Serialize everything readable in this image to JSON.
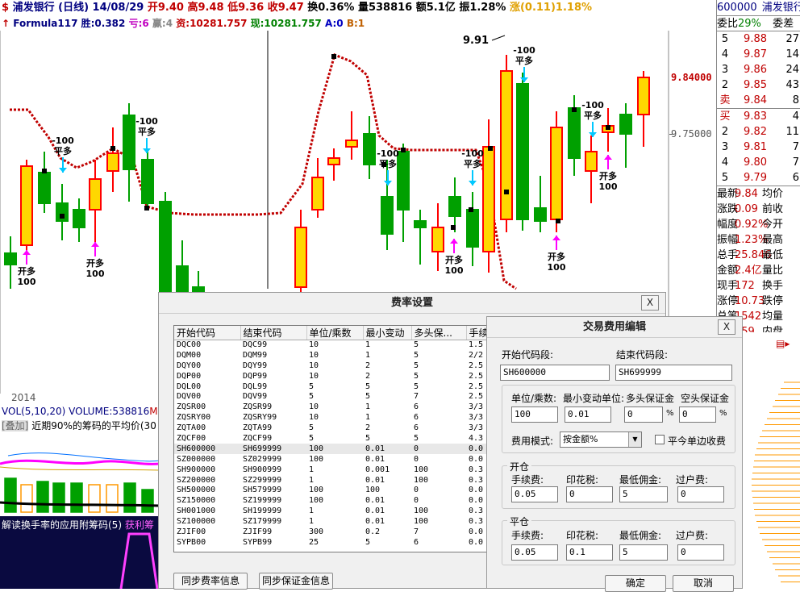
{
  "header": {
    "icon": "$",
    "stock_name": "浦发银行",
    "period": "(日线)",
    "date": "14/08/29",
    "open": "开9.40",
    "high": "高9.48",
    "low": "低9.36",
    "close": "收9.47",
    "turnover": "换0.36%",
    "volume": "量538816",
    "amount": "额5.1亿",
    "amplitude": "振1.28%",
    "change": "涨(0.11)1.18%"
  },
  "indicator_bar": {
    "arrow": "↑",
    "name": "Formula117",
    "win": "胜:0.382",
    "loss": "亏:6",
    "gain": "赢:4",
    "capital": "资:10281.757",
    "current": "现:10281.757",
    "a": "A:0",
    "b": "B:1"
  },
  "chart_data": {
    "type": "candlestick",
    "high_label": "9.91",
    "price_ticks": [
      "9.84000",
      "9.75000"
    ],
    "year_label": "2014",
    "signals": [
      {
        "text1": "-100",
        "text2": "平多"
      },
      {
        "text1": "开多",
        "text2": "100"
      }
    ]
  },
  "volume_panel": {
    "label": "VOL(5,10,20)",
    "value": "VOLUME:538816",
    "tag": "M",
    "line2_tag": "[叠加]",
    "line2_text": "近期90%的筹码的平均价(30"
  },
  "bottom_panel": {
    "text": "解读换手率的应用附筹码(5)",
    "tag": "获利筹"
  },
  "right_panel": {
    "code": "600000",
    "name": "浦发银行",
    "weibi_label": "委比",
    "weibi_value": "29%",
    "weicha_label": "委差",
    "sell": [
      {
        "level": "5",
        "price": "9.88",
        "vol": "27"
      },
      {
        "level": "4",
        "price": "9.87",
        "vol": "14"
      },
      {
        "level": "3",
        "price": "9.86",
        "vol": "24"
      },
      {
        "level": "2",
        "price": "9.85",
        "vol": "43"
      },
      {
        "level": "卖",
        "price": "9.84",
        "vol": "8"
      }
    ],
    "buy": [
      {
        "level": "买",
        "price": "9.83",
        "vol": "4"
      },
      {
        "level": "2",
        "price": "9.82",
        "vol": "11"
      },
      {
        "level": "3",
        "price": "9.81",
        "vol": "7"
      },
      {
        "level": "4",
        "price": "9.80",
        "vol": "7"
      },
      {
        "level": "5",
        "price": "9.79",
        "vol": "6"
      }
    ],
    "stats": [
      {
        "k1": "最新",
        "v1": "9.84",
        "k2": "均价"
      },
      {
        "k1": "涨跌",
        "v1": "0.09",
        "k2": "前收"
      },
      {
        "k1": "幅度",
        "v1": "0.92%",
        "k2": "今开"
      },
      {
        "k1": "振幅",
        "v1": "1.23%",
        "k2": "最高"
      },
      {
        "k1": "总手",
        "v1": "25.846",
        "k2": "最低"
      },
      {
        "k1": "金额",
        "v1": "2.4亿",
        "k2": "量比"
      },
      {
        "k1": "现手",
        "v1": "172",
        "k2": "换手"
      },
      {
        "k1": "涨停",
        "v1": "10.73",
        "k2": "跌停"
      },
      {
        "k1": "总笔",
        "v1": "1542",
        "k2": "均量"
      },
      {
        "k1": "",
        "v1": "559",
        "k2": "内盘"
      }
    ]
  },
  "fee_dialog": {
    "title": "费率设置",
    "close": "X",
    "columns": [
      "开始代码",
      "结束代码",
      "单位/乘数",
      "最小变动",
      "多头保...",
      "手续"
    ],
    "rows": [
      [
        "DQC00",
        "DQC99",
        "10",
        "1",
        "5",
        "1.5"
      ],
      [
        "DQM00",
        "DQM99",
        "10",
        "1",
        "5",
        "2/2"
      ],
      [
        "DQY00",
        "DQY99",
        "10",
        "2",
        "5",
        "2.5"
      ],
      [
        "DQP00",
        "DQP99",
        "10",
        "2",
        "5",
        "2.5"
      ],
      [
        "DQL00",
        "DQL99",
        "5",
        "5",
        "5",
        "2.5"
      ],
      [
        "DQV00",
        "DQV99",
        "5",
        "5",
        "7",
        "2.5"
      ],
      [
        "ZQSR00",
        "ZQSR99",
        "10",
        "1",
        "6",
        "3/3"
      ],
      [
        "ZQSRY00",
        "ZQSRY99",
        "10",
        "1",
        "6",
        "3/3"
      ],
      [
        "ZQTA00",
        "ZQTA99",
        "5",
        "2",
        "6",
        "3/3"
      ],
      [
        "ZQCF00",
        "ZQCF99",
        "5",
        "5",
        "5",
        "4.3"
      ],
      [
        "SH600000",
        "SH699999",
        "100",
        "0.01",
        "0",
        "0.0"
      ],
      [
        "SZ000000",
        "SZ029999",
        "100",
        "0.01",
        "0",
        "0.0"
      ],
      [
        "SH900000",
        "SH900999",
        "1",
        "0.001",
        "100",
        "0.3"
      ],
      [
        "SZ200000",
        "SZ299999",
        "1",
        "0.01",
        "100",
        "0.3"
      ],
      [
        "SH500000",
        "SH579999",
        "100",
        "100",
        "0",
        "0.0"
      ],
      [
        "SZ150000",
        "SZ199999",
        "100",
        "0.01",
        "0",
        "0.0"
      ],
      [
        "SH001000",
        "SH199999",
        "1",
        "0.01",
        "100",
        "0.3"
      ],
      [
        "SZ100000",
        "SZ179999",
        "1",
        "0.01",
        "100",
        "0.3"
      ],
      [
        "ZJIF00",
        "ZJIF99",
        "300",
        "0.2",
        "7",
        "0.0"
      ],
      [
        "SYPB00",
        "SYPB99",
        "25",
        "5",
        "6",
        "0.0"
      ]
    ],
    "sync_rate_button": "同步费率信息",
    "sync_margin_button": "同步保证金信息"
  },
  "edit_dialog": {
    "title": "交易费用编辑",
    "close": "X",
    "start_code_label": "开始代码段:",
    "end_code_label": "结束代码段:",
    "start_code": "SH600000",
    "end_code": "SH699999",
    "unit_label": "单位/乘数:",
    "min_tick_label": "最小变动单位:",
    "long_margin_label": "多头保证金",
    "short_margin_label": "空头保证金",
    "unit": "100",
    "min_tick": "0.01",
    "long_margin": "0",
    "short_margin": "0",
    "percent": "%",
    "fee_mode_label": "费用模式:",
    "fee_mode": "按金额%",
    "close_today_label": "平今单边收费",
    "open_group": "开仓",
    "close_group": "平仓",
    "commission_label": "手续费:",
    "stamp_label": "印花税:",
    "min_commission_label": "最低佣金:",
    "transfer_label": "过户费:",
    "open_commission": "0.05",
    "open_stamp": "0",
    "open_min": "5",
    "open_transfer": "0",
    "close_commission": "0.05",
    "close_stamp": "0.1",
    "close_min": "5",
    "close_transfer": "0",
    "ok": "确定",
    "cancel": "取消"
  },
  "colors": {
    "up": "#ff0000",
    "down": "#00a000",
    "price_red": "#c00000"
  }
}
